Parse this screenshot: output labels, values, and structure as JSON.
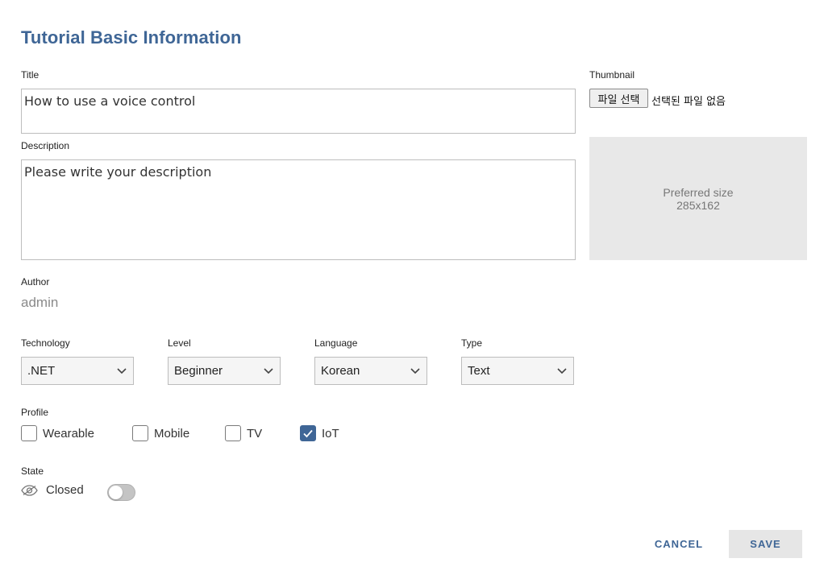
{
  "page_title": "Tutorial Basic Information",
  "title_field": {
    "label": "Title",
    "value": "How to use a voice control"
  },
  "description_field": {
    "label": "Description",
    "placeholder": "Please write your description"
  },
  "thumbnail": {
    "label": "Thumbnail",
    "file_button": "파일 선택",
    "file_status": "선택된 파일 없음",
    "preview_line1": "Preferred size",
    "preview_line2": "285x162"
  },
  "author": {
    "label": "Author",
    "value": "admin"
  },
  "selects": {
    "technology": {
      "label": "Technology",
      "value": ".NET"
    },
    "level": {
      "label": "Level",
      "value": "Beginner"
    },
    "language": {
      "label": "Language",
      "value": "Korean"
    },
    "type": {
      "label": "Type",
      "value": "Text"
    }
  },
  "profile": {
    "label": "Profile",
    "options": [
      {
        "label": "Wearable",
        "checked": false
      },
      {
        "label": "Mobile",
        "checked": false
      },
      {
        "label": "TV",
        "checked": false
      },
      {
        "label": "IoT",
        "checked": true
      }
    ]
  },
  "state": {
    "label": "State",
    "value": "Closed",
    "toggle_on": false,
    "icon": "eye-icon"
  },
  "actions": {
    "cancel": "CANCEL",
    "save": "SAVE"
  },
  "colors": {
    "accent": "#3f6696",
    "placeholder_bg": "#e8e8e8"
  }
}
